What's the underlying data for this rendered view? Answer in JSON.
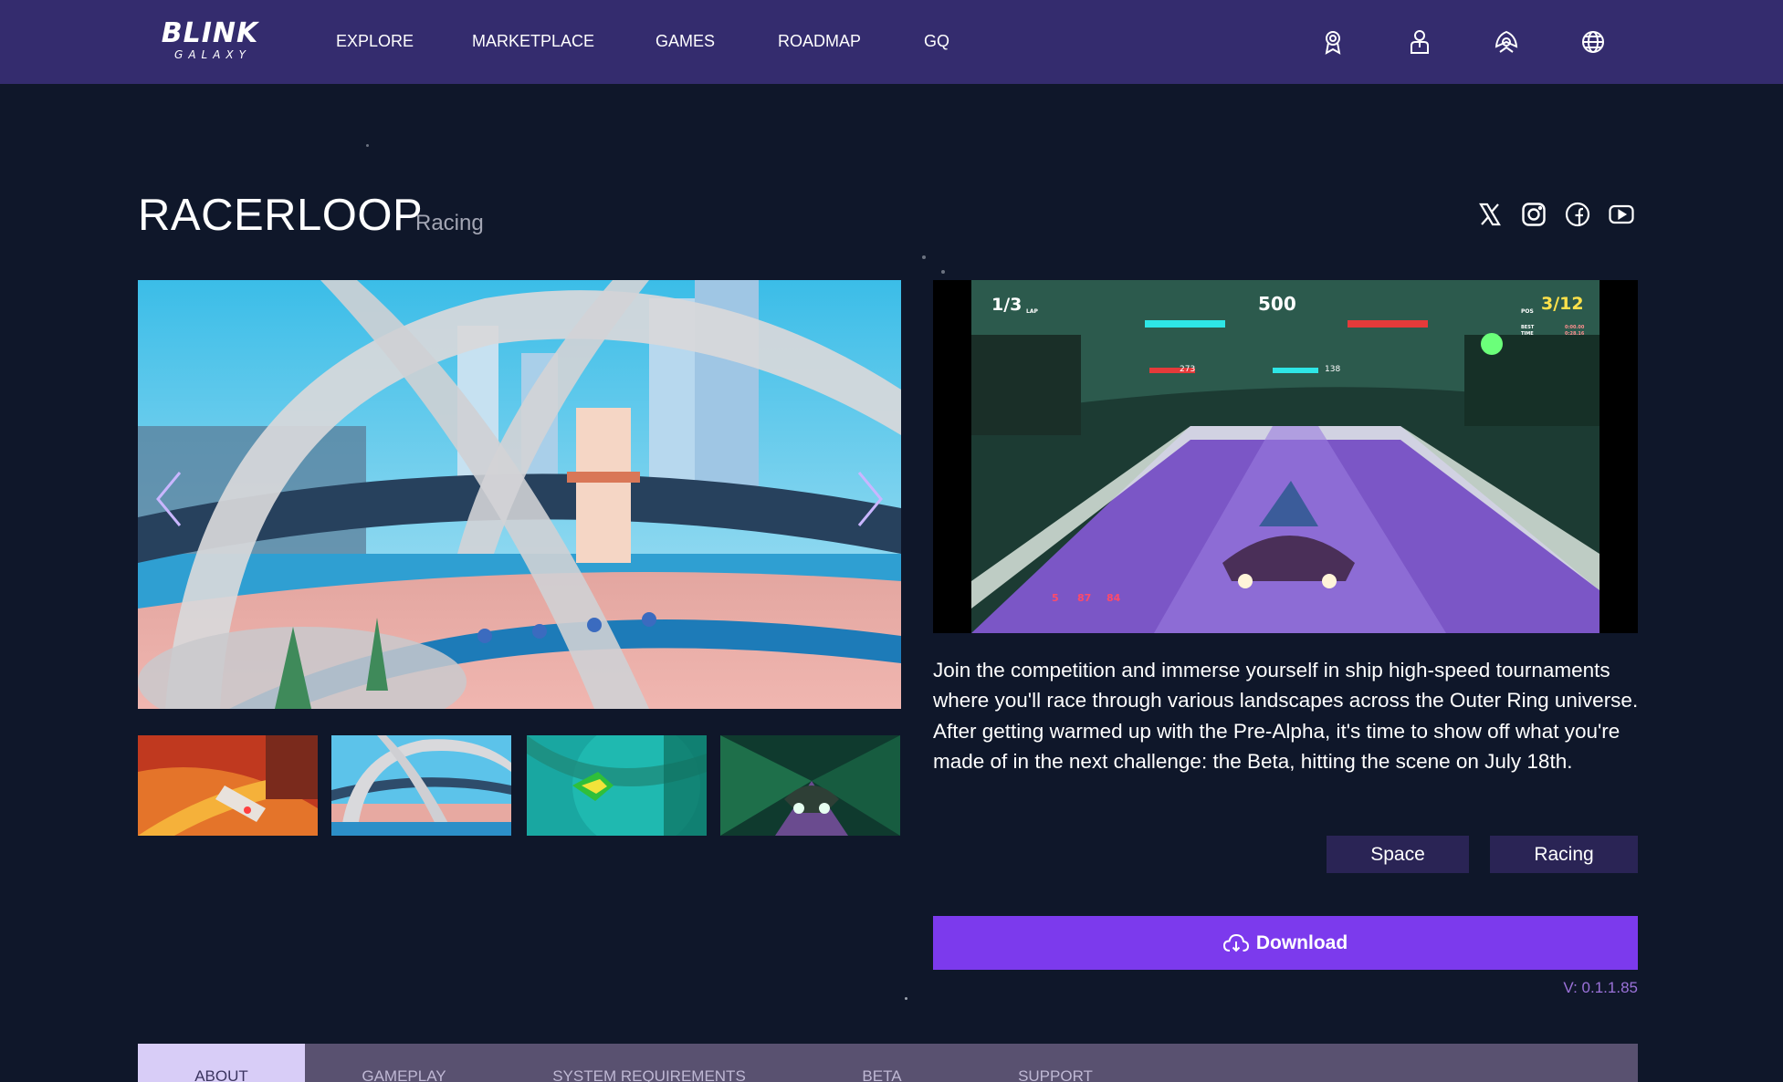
{
  "header": {
    "logo_main": "BLINK",
    "logo_sub": "GALAXY",
    "nav": [
      "EXPLORE",
      "MARKETPLACE",
      "GAMES",
      "ROADMAP",
      "GQ"
    ],
    "icons": [
      "award-icon",
      "user-icon",
      "achievements-icon",
      "globe-icon"
    ]
  },
  "game": {
    "title": "RACERLOOP",
    "genre": "Racing",
    "social_icons": [
      "x-icon",
      "instagram-icon",
      "facebook-icon",
      "youtube-icon"
    ],
    "description": "Join the competition and immerse yourself in ship high-speed tournaments where you'll race through various landscapes across the Outer Ring universe. After getting warmed up with the Pre-Alpha, it's time to show off what you're made of in the next challenge: the Beta, hitting the scene on July 18th.",
    "tags": [
      "Space",
      "Racing"
    ],
    "download_label": "Download",
    "version": "V: 0.1.1.85"
  },
  "video_hud": {
    "lap": "1/3",
    "lap_label": "LAP",
    "score": "500",
    "position": "3/12",
    "position_label": "POS",
    "best_label": "BEST",
    "time_label": "TIME",
    "best_time": "0:00.00",
    "time": "0:28.16",
    "left_value": "273",
    "right_value": "138",
    "speed_values": [
      "5",
      "87",
      "84"
    ]
  },
  "tabs": [
    "ABOUT",
    "GAMEPLAY",
    "SYSTEM REQUIREMENTS",
    "BETA",
    "SUPPORT"
  ],
  "active_tab": "ABOUT",
  "colors": {
    "background": "#0f172a",
    "nav": "#342c6e",
    "accent": "#7c3aed",
    "tag": "#2a2455",
    "tab_bar": "#595170",
    "tab_active": "#d8cdf7",
    "version": "#9b72d9"
  }
}
